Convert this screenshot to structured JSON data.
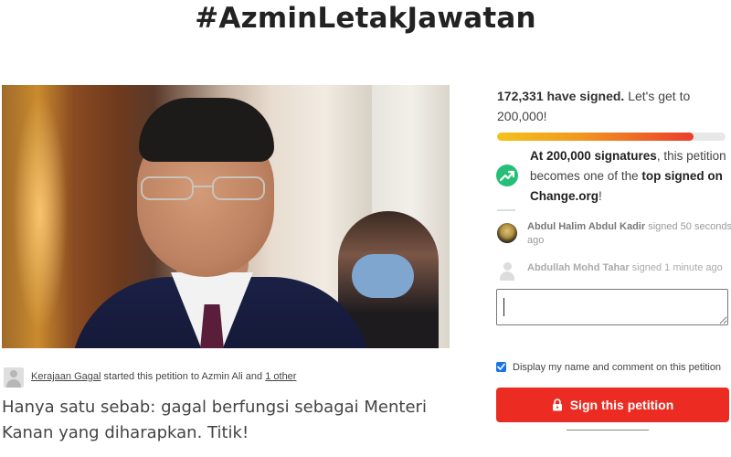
{
  "page": {
    "title": "#AzminLetakJawatan"
  },
  "starter": {
    "name": "Kerajaan Gagal",
    "middle_text": " started this petition to Azmin Ali and ",
    "others": "1 other"
  },
  "description": "Hanya satu sebab: gagal berfungsi sebagai Menteri Kanan yang diharapkan. Titik!",
  "signatures": {
    "count_text": "172,331 have signed.",
    "goal_text": " Let's get to 200,000!",
    "progress_fraction": 0.86,
    "milestone_bold1": "At 200,000 signatures",
    "milestone_mid": ", this petition becomes one of the ",
    "milestone_bold2": "top signed on Change.org",
    "milestone_end": "!"
  },
  "recent_signers": [
    {
      "name": "Abdul Halim Abdul Kadir",
      "action": " signed 50 seconds ago"
    },
    {
      "name": "Abdullah Mohd Tahar",
      "action": " signed 1 minute ago"
    }
  ],
  "form": {
    "comment_value": "",
    "display_label": "Display my name and comment on this petition",
    "display_checked": true,
    "sign_button_label": "Sign this petition"
  },
  "colors": {
    "sign_button": "#ec2c22",
    "progress_start": "#f4c21b",
    "progress_end": "#ec3d2b",
    "trend_icon": "#26bf78"
  },
  "icons": {
    "milestone": "trending-up-icon",
    "sign_button": "lock-icon",
    "checkbox": "check-icon",
    "starter_avatar": "user-avatar-icon"
  }
}
